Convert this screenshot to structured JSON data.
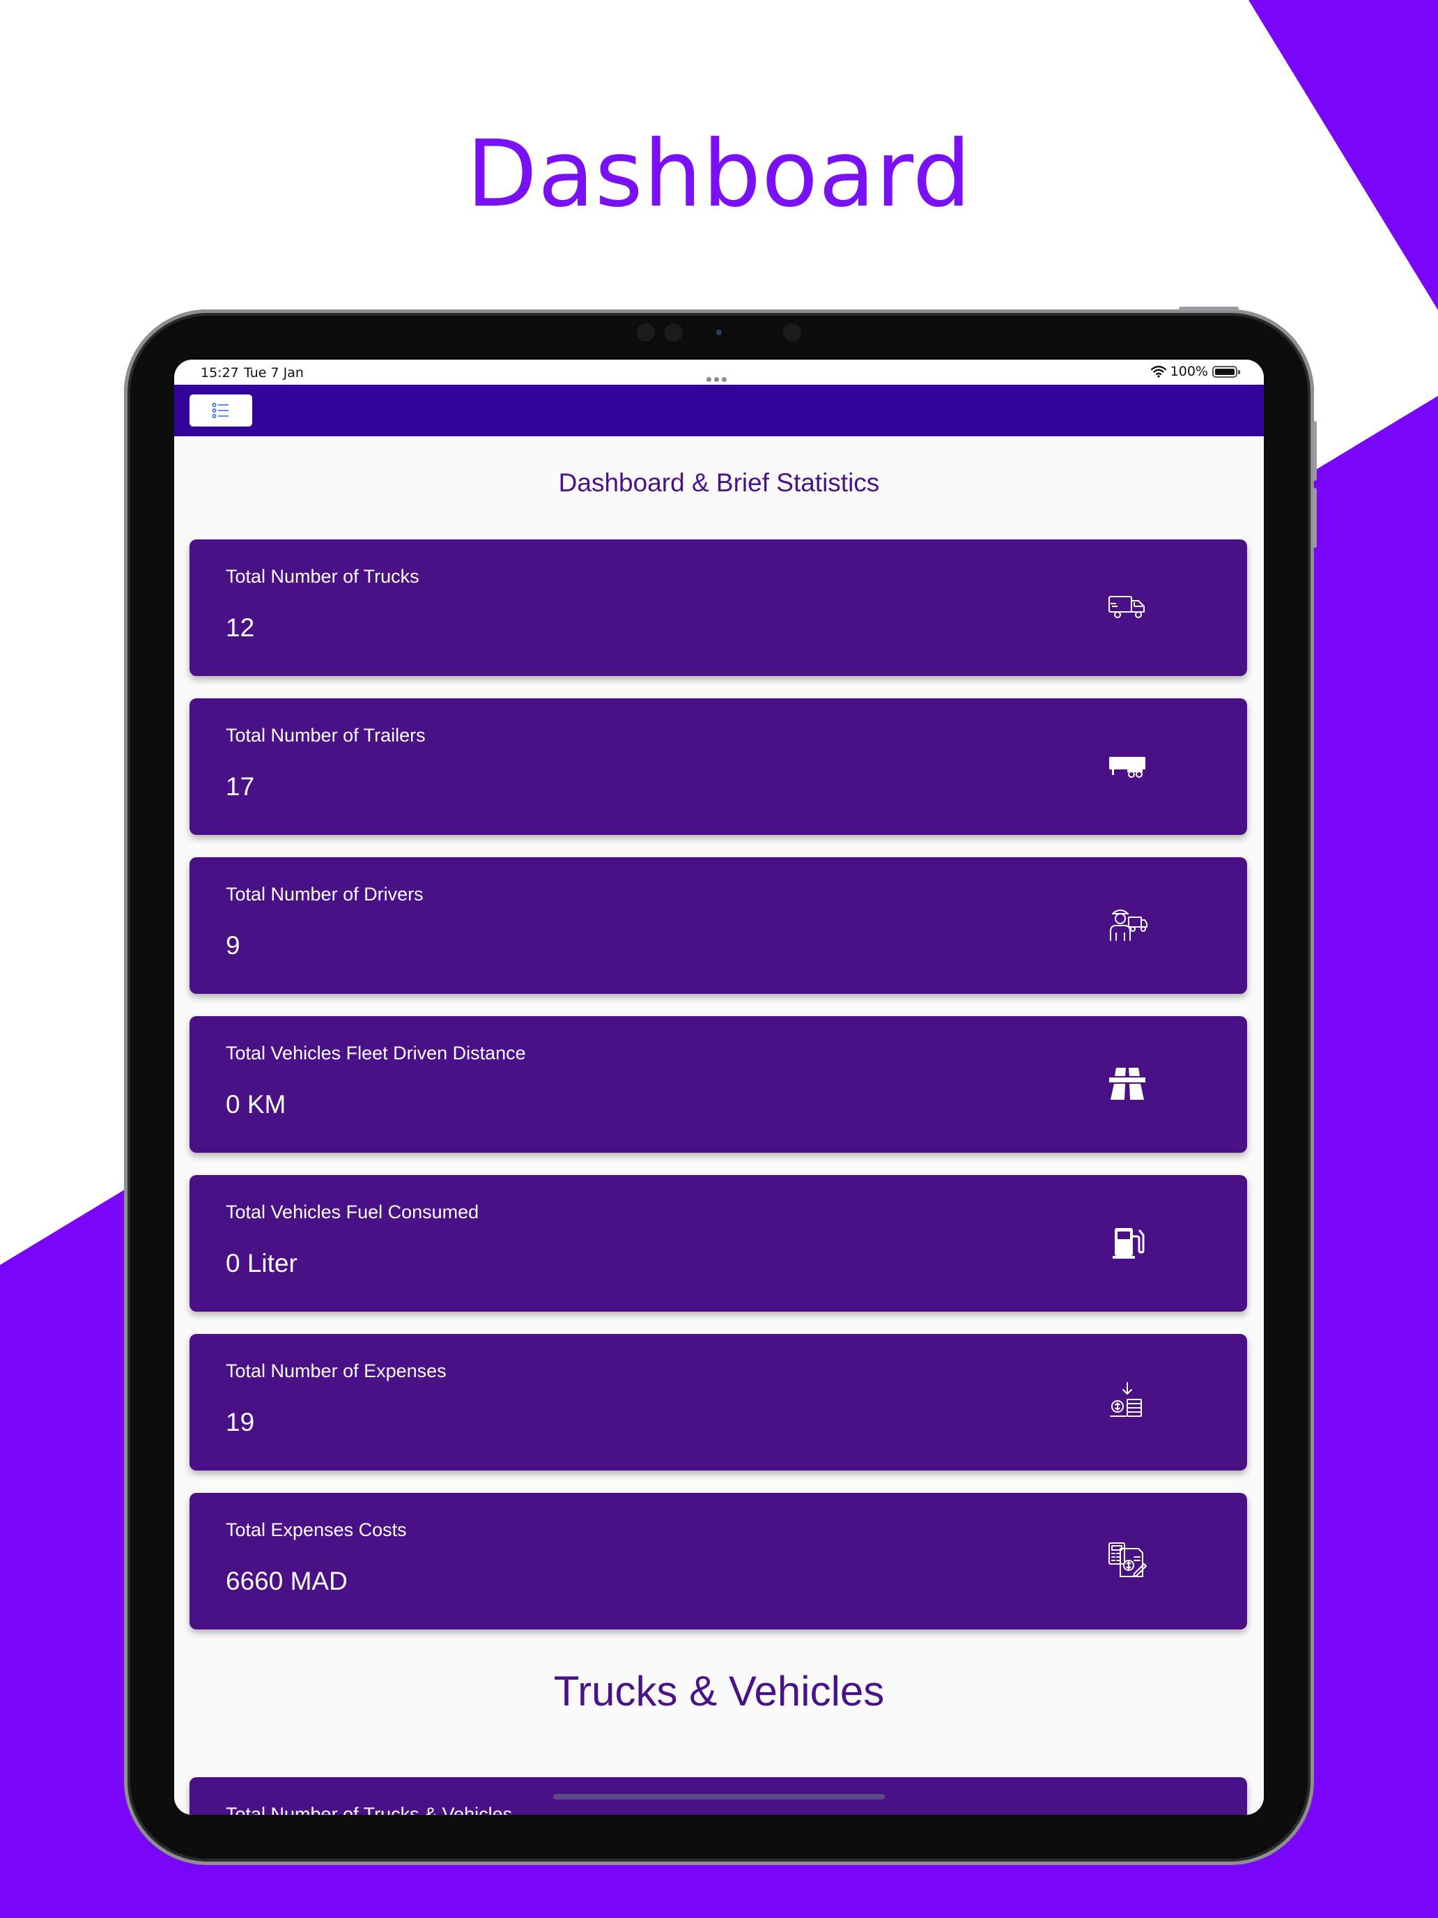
{
  "promo": {
    "title": "Dashboard"
  },
  "status_bar": {
    "time": "15:27",
    "date": "Tue 7 Jan",
    "battery": "100%"
  },
  "nav": {
    "menu_icon": "list-icon"
  },
  "sections": {
    "brief_title": "Dashboard & Brief Statistics",
    "trucks_title": "Trucks & Vehicles"
  },
  "cards": [
    {
      "label": "Total Number of Trucks",
      "value": "12",
      "icon": "truck-icon"
    },
    {
      "label": "Total Number of Trailers",
      "value": "17",
      "icon": "trailer-icon"
    },
    {
      "label": "Total Number of Drivers",
      "value": "9",
      "icon": "driver-icon"
    },
    {
      "label": "Total Vehicles Fleet Driven Distance",
      "value": "0 KM",
      "icon": "road-icon"
    },
    {
      "label": "Total Vehicles Fuel Consumed",
      "value": "0 Liter",
      "icon": "fuel-pump-icon"
    },
    {
      "label": "Total Number of Expenses",
      "value": "19",
      "icon": "expenses-icon"
    },
    {
      "label": "Total Expenses Costs",
      "value": "6660 MAD",
      "icon": "invoice-icon"
    }
  ],
  "partial_card": {
    "label": "Total Number of Trucks & Vehicles"
  },
  "colors": {
    "accent": "#7a10f5",
    "nav": "#33049b",
    "card": "#4a1187",
    "title_text": "#4a128a"
  }
}
